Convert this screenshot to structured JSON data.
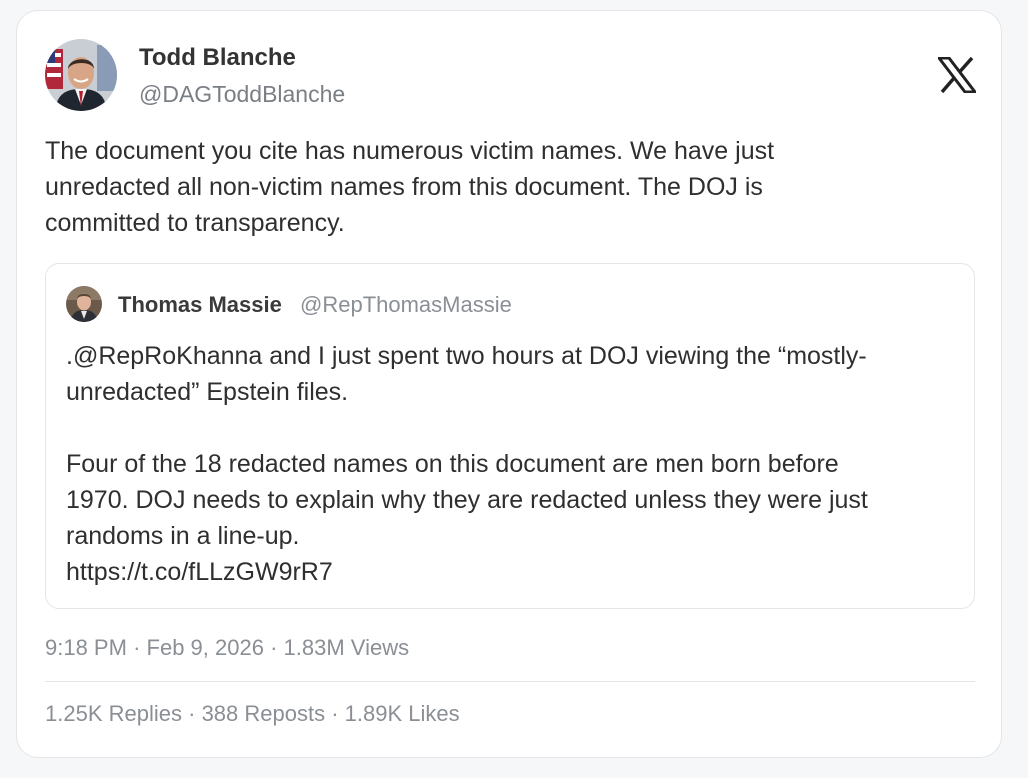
{
  "tweet": {
    "author": {
      "name": "Todd Blanche",
      "handle": "@DAGToddBlanche"
    },
    "logo_icon": "x-logo-icon",
    "text_lines": [
      "The document you cite has numerous victim names. We have just",
      "unredacted all non-victim names from this document. The DOJ is",
      "committed to transparency."
    ],
    "quoted": {
      "author_name": "Thomas Massie",
      "author_handle": "@RepThomasMassie",
      "lines_para1": [
        ".@RepRoKhanna and I just spent two hours at DOJ viewing the “mostly-",
        "unredacted” Epstein files."
      ],
      "lines_para2": [
        "Four of the 18 redacted names on this document are men born before",
        "1970. DOJ needs to explain why they are redacted unless they were just",
        "randoms in a line-up."
      ],
      "link": "https://t.co/fLLzGW9rR7"
    },
    "meta": {
      "time": "9:18 PM",
      "date": "Feb 9, 2026",
      "views": "1.83M Views",
      "separator": "·"
    },
    "stats": {
      "replies": "1.25K Replies",
      "reposts": "388 Reposts",
      "likes": "1.89K Likes",
      "separator": "·"
    }
  },
  "colors": {
    "text": "#2f2f2f",
    "muted": "#8a8f95",
    "border": "#e3e5e8"
  }
}
